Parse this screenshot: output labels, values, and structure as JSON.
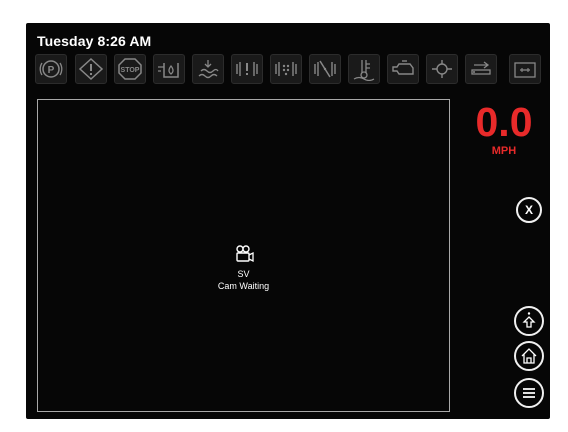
{
  "header": {
    "datetime": "Tuesday 8:26 AM"
  },
  "indicators": [
    {
      "icon": "parking-brake-icon"
    },
    {
      "icon": "warning-triangle-icon"
    },
    {
      "icon": "stop-icon"
    },
    {
      "icon": "fuel-water-icon"
    },
    {
      "icon": "coolant-level-icon"
    },
    {
      "icon": "dpf-warning-icon"
    },
    {
      "icon": "dpf-regen-icon"
    },
    {
      "icon": "dpf-inhibit-icon"
    },
    {
      "icon": "coolant-temp-icon"
    },
    {
      "icon": "engine-check-icon"
    },
    {
      "icon": "engine-oil-icon"
    },
    {
      "icon": "transmission-icon"
    },
    {
      "icon": "battery-icon"
    }
  ],
  "camera": {
    "source": "SV",
    "status": "Cam Waiting"
  },
  "speed": {
    "value": "0.0",
    "unit": "MPH"
  },
  "buttons": {
    "close_label": "X"
  },
  "colors": {
    "speed": "#e82a2a",
    "background": "#060606",
    "frame": "#a8a8a8"
  }
}
